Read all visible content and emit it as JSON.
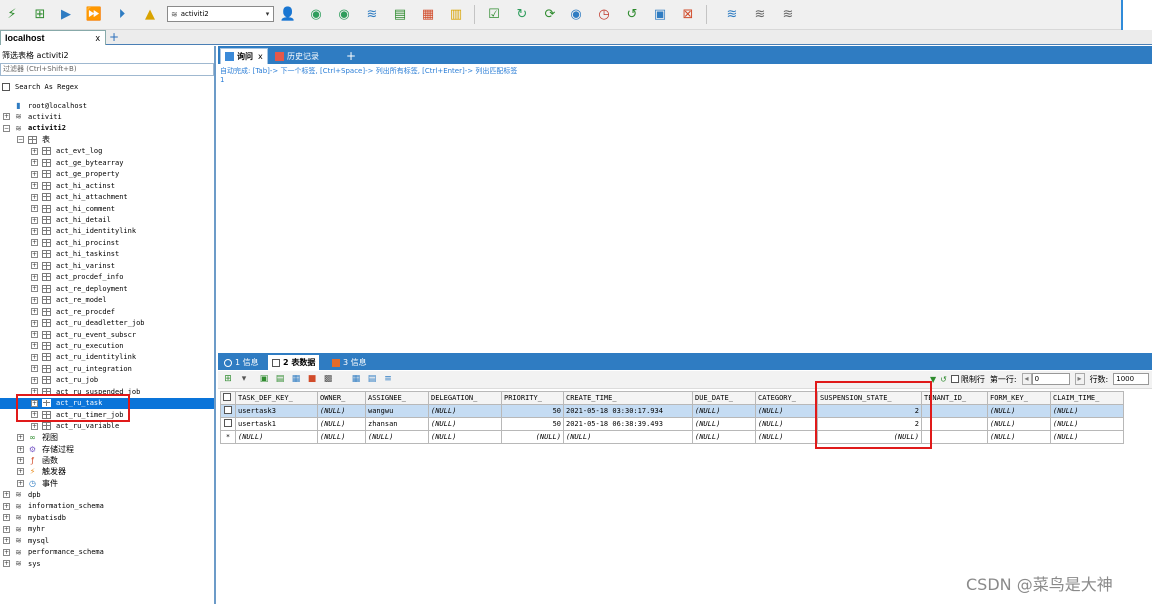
{
  "toolbar": {
    "database_selector": "activiti2",
    "icons": [
      "connect-icon",
      "new-query-icon",
      "execute-icon",
      "execute-all-icon",
      "execute-current-icon",
      "schema-designer-icon",
      "user-icon",
      "backup-icon",
      "restore-icon",
      "import-icon",
      "export-icon",
      "compare-icon",
      "grid-icon",
      "report-icon",
      "refresh-icon",
      "sync-icon",
      "schedule-icon",
      "job-icon",
      "history-icon",
      "window-icon",
      "layout-icon",
      "tools-icon",
      "db-sync-icon",
      "db-copy-icon"
    ]
  },
  "connection_tab": {
    "label": "localhost",
    "close": "x",
    "add": "+"
  },
  "left_panel": {
    "title": "筛选表格 activiti2",
    "filter_placeholder": "过滤器 (Ctrl+Shift+B)",
    "regex_label": "Search As Regex",
    "tree": [
      {
        "label": "root@localhost",
        "kind": "server",
        "level": 0
      },
      {
        "label": "activiti",
        "kind": "db",
        "level": 0,
        "exp": "+"
      },
      {
        "label": "activiti2",
        "kind": "db",
        "level": 0,
        "exp": "-",
        "bold": true
      },
      {
        "label": "表",
        "kind": "folder",
        "level": 1,
        "exp": "-",
        "zh": true
      },
      {
        "label": "act_evt_log",
        "kind": "table",
        "level": 2,
        "exp": "+"
      },
      {
        "label": "act_ge_bytearray",
        "kind": "table",
        "level": 2,
        "exp": "+"
      },
      {
        "label": "act_ge_property",
        "kind": "table",
        "level": 2,
        "exp": "+"
      },
      {
        "label": "act_hi_actinst",
        "kind": "table",
        "level": 2,
        "exp": "+"
      },
      {
        "label": "act_hi_attachment",
        "kind": "table",
        "level": 2,
        "exp": "+"
      },
      {
        "label": "act_hi_comment",
        "kind": "table",
        "level": 2,
        "exp": "+"
      },
      {
        "label": "act_hi_detail",
        "kind": "table",
        "level": 2,
        "exp": "+"
      },
      {
        "label": "act_hi_identitylink",
        "kind": "table",
        "level": 2,
        "exp": "+"
      },
      {
        "label": "act_hi_procinst",
        "kind": "table",
        "level": 2,
        "exp": "+"
      },
      {
        "label": "act_hi_taskinst",
        "kind": "table",
        "level": 2,
        "exp": "+"
      },
      {
        "label": "act_hi_varinst",
        "kind": "table",
        "level": 2,
        "exp": "+"
      },
      {
        "label": "act_procdef_info",
        "kind": "table",
        "level": 2,
        "exp": "+"
      },
      {
        "label": "act_re_deployment",
        "kind": "table",
        "level": 2,
        "exp": "+"
      },
      {
        "label": "act_re_model",
        "kind": "table",
        "level": 2,
        "exp": "+"
      },
      {
        "label": "act_re_procdef",
        "kind": "table",
        "level": 2,
        "exp": "+"
      },
      {
        "label": "act_ru_deadletter_job",
        "kind": "table",
        "level": 2,
        "exp": "+"
      },
      {
        "label": "act_ru_event_subscr",
        "kind": "table",
        "level": 2,
        "exp": "+"
      },
      {
        "label": "act_ru_execution",
        "kind": "table",
        "level": 2,
        "exp": "+"
      },
      {
        "label": "act_ru_identitylink",
        "kind": "table",
        "level": 2,
        "exp": "+"
      },
      {
        "label": "act_ru_integration",
        "kind": "table",
        "level": 2,
        "exp": "+"
      },
      {
        "label": "act_ru_job",
        "kind": "table",
        "level": 2,
        "exp": "+"
      },
      {
        "label": "act_ru_suspended_job",
        "kind": "table",
        "level": 2,
        "exp": "+"
      },
      {
        "label": "act_ru_task",
        "kind": "table",
        "level": 2,
        "exp": "+",
        "selected": true
      },
      {
        "label": "act_ru_timer_job",
        "kind": "table",
        "level": 2,
        "exp": "+"
      },
      {
        "label": "act_ru_variable",
        "kind": "table",
        "level": 2,
        "exp": "+"
      },
      {
        "label": "视图",
        "kind": "view",
        "level": 1,
        "exp": "+",
        "zh": true
      },
      {
        "label": "存储过程",
        "kind": "proc",
        "level": 1,
        "exp": "+",
        "zh": true
      },
      {
        "label": "函数",
        "kind": "func",
        "level": 1,
        "exp": "+",
        "zh": true
      },
      {
        "label": "触发器",
        "kind": "trigger",
        "level": 1,
        "exp": "+",
        "zh": true
      },
      {
        "label": "事件",
        "kind": "event",
        "level": 1,
        "exp": "+",
        "zh": true
      },
      {
        "label": "dpb",
        "kind": "db",
        "level": 0,
        "exp": "+"
      },
      {
        "label": "information_schema",
        "kind": "db",
        "level": 0,
        "exp": "+"
      },
      {
        "label": "mybatisdb",
        "kind": "db",
        "level": 0,
        "exp": "+"
      },
      {
        "label": "myhr",
        "kind": "db",
        "level": 0,
        "exp": "+"
      },
      {
        "label": "mysql",
        "kind": "db",
        "level": 0,
        "exp": "+"
      },
      {
        "label": "performance_schema",
        "kind": "db",
        "level": 0,
        "exp": "+"
      },
      {
        "label": "sys",
        "kind": "db",
        "level": 0,
        "exp": "+"
      }
    ]
  },
  "editor": {
    "tabs": [
      {
        "label": "询问",
        "close": "x"
      },
      {
        "label": "历史记录"
      }
    ],
    "add": "+",
    "hint": "自动完成: [Tab]-> 下一个标签, [Ctrl+Space]-> 列出所有标签, [Ctrl+Enter]-> 列出匹配标签",
    "line": "1"
  },
  "results": {
    "tabs": [
      "1 信息",
      "2 表数据",
      "3 信息"
    ],
    "limit_label": "限制行",
    "first_row_label": "第一行:",
    "first_row_value": "0",
    "rows_label": "行数:",
    "rows_value": "1000",
    "columns": [
      "TASK_DEF_KEY_",
      "OWNER_",
      "ASSIGNEE_",
      "DELEGATION_",
      "PRIORITY_",
      "CREATE_TIME_",
      "DUE_DATE_",
      "CATEGORY_",
      "SUSPENSION_STATE_",
      "TENANT_ID_",
      "FORM_KEY_",
      "CLAIM_TIME_"
    ],
    "rows": [
      {
        "marker": "",
        "values": [
          "usertask3",
          "(NULL)",
          "wangwu",
          "(NULL)",
          "50",
          "2021-05-18 03:30:17.934",
          "(NULL)",
          "(NULL)",
          "2",
          "",
          "(NULL)",
          "(NULL)"
        ]
      },
      {
        "marker": "",
        "values": [
          "usertask1",
          "(NULL)",
          "zhansan",
          "(NULL)",
          "50",
          "2021-05-18 06:38:39.493",
          "(NULL)",
          "(NULL)",
          "2",
          "",
          "(NULL)",
          "(NULL)"
        ]
      },
      {
        "marker": "*",
        "values": [
          "(NULL)",
          "(NULL)",
          "(NULL)",
          "(NULL)",
          "(NULL)",
          "(NULL)",
          "(NULL)",
          "(NULL)",
          "(NULL)",
          "",
          "(NULL)",
          "(NULL)"
        ]
      }
    ]
  },
  "watermark": "CSDN @菜鸟是大神"
}
